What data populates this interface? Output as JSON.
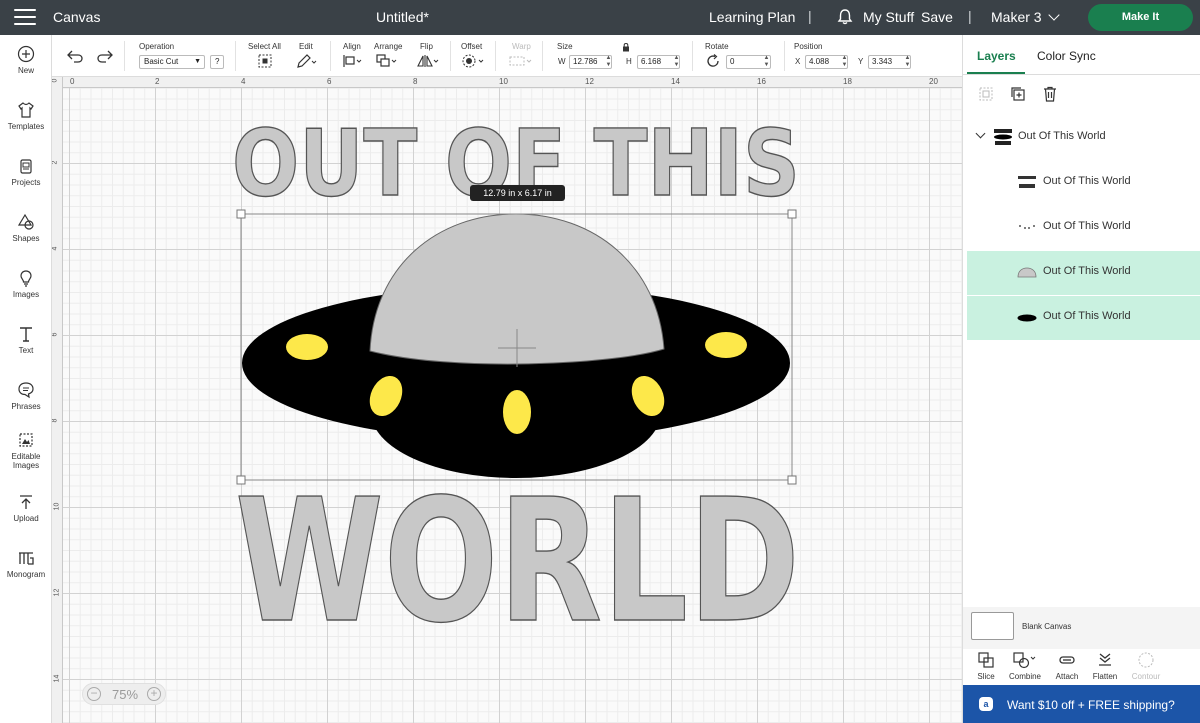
{
  "header": {
    "app_name": "Canvas",
    "doc_title": "Untitled*",
    "learning_plan": "Learning Plan",
    "my_stuff": "My Stuff",
    "save": "Save",
    "machine": "Maker 3",
    "make_it": "Make It",
    "separator": "|"
  },
  "left_nav": [
    {
      "label": "New",
      "icon": "plus-circle-icon"
    },
    {
      "label": "Templates",
      "icon": "shirt-icon"
    },
    {
      "label": "Projects",
      "icon": "projects-icon"
    },
    {
      "label": "Shapes",
      "icon": "shapes-icon"
    },
    {
      "label": "Images",
      "icon": "lightbulb-icon"
    },
    {
      "label": "Text",
      "icon": "text-icon"
    },
    {
      "label": "Phrases",
      "icon": "speech-bubble-icon"
    },
    {
      "label": "Editable Images",
      "icon": "editable-image-icon"
    },
    {
      "label": "Upload",
      "icon": "upload-icon"
    },
    {
      "label": "Monogram",
      "icon": "monogram-icon"
    }
  ],
  "toolbar": {
    "operation_label": "Operation",
    "operation_value": "Basic Cut",
    "help": "?",
    "select_all": "Select All",
    "edit": "Edit",
    "align": "Align",
    "arrange": "Arrange",
    "flip": "Flip",
    "offset": "Offset",
    "warp": "Warp",
    "size": "Size",
    "w_label": "W",
    "w_value": "12.786",
    "h_label": "H",
    "h_value": "6.168",
    "rotate": "Rotate",
    "rotate_value": "0",
    "position": "Position",
    "x_label": "X",
    "x_value": "4.088",
    "y_label": "Y",
    "y_value": "3.343"
  },
  "canvas": {
    "ruler_top": [
      "0",
      "2",
      "4",
      "6",
      "8",
      "10",
      "12",
      "14",
      "16",
      "18",
      "20"
    ],
    "ruler_left": [
      "0",
      "2",
      "4",
      "6",
      "8",
      "10",
      "12",
      "14"
    ],
    "dimension_tooltip": "12.79  in x 6.17  in",
    "zoom": "75%",
    "zoom_out": "−",
    "zoom_in": "+",
    "headline_top": "OUT OF THIS",
    "headline_bottom": "WORLD",
    "colors": {
      "ufo_body": "#000000",
      "ufo_dome": "#c8c8c8",
      "ufo_lights": "#fde84a",
      "text_fill": "#c8c8c8"
    }
  },
  "right_panel": {
    "tab_layers": "Layers",
    "tab_color_sync": "Color Sync",
    "group_name": "Out Of This World",
    "layers": [
      {
        "name": "Out Of This World",
        "selected": false
      },
      {
        "name": "Out Of This World",
        "selected": false
      },
      {
        "name": "Out Of This World",
        "selected": true
      },
      {
        "name": "Out Of This World",
        "selected": true
      }
    ],
    "blank_canvas": "Blank Canvas",
    "tools": [
      "Slice",
      "Combine",
      "Attach",
      "Flatten",
      "Contour"
    ],
    "promo": "Want $10 off + FREE shipping?",
    "promo_icon_glyph": "a",
    "accent": "#1a7f4f"
  }
}
